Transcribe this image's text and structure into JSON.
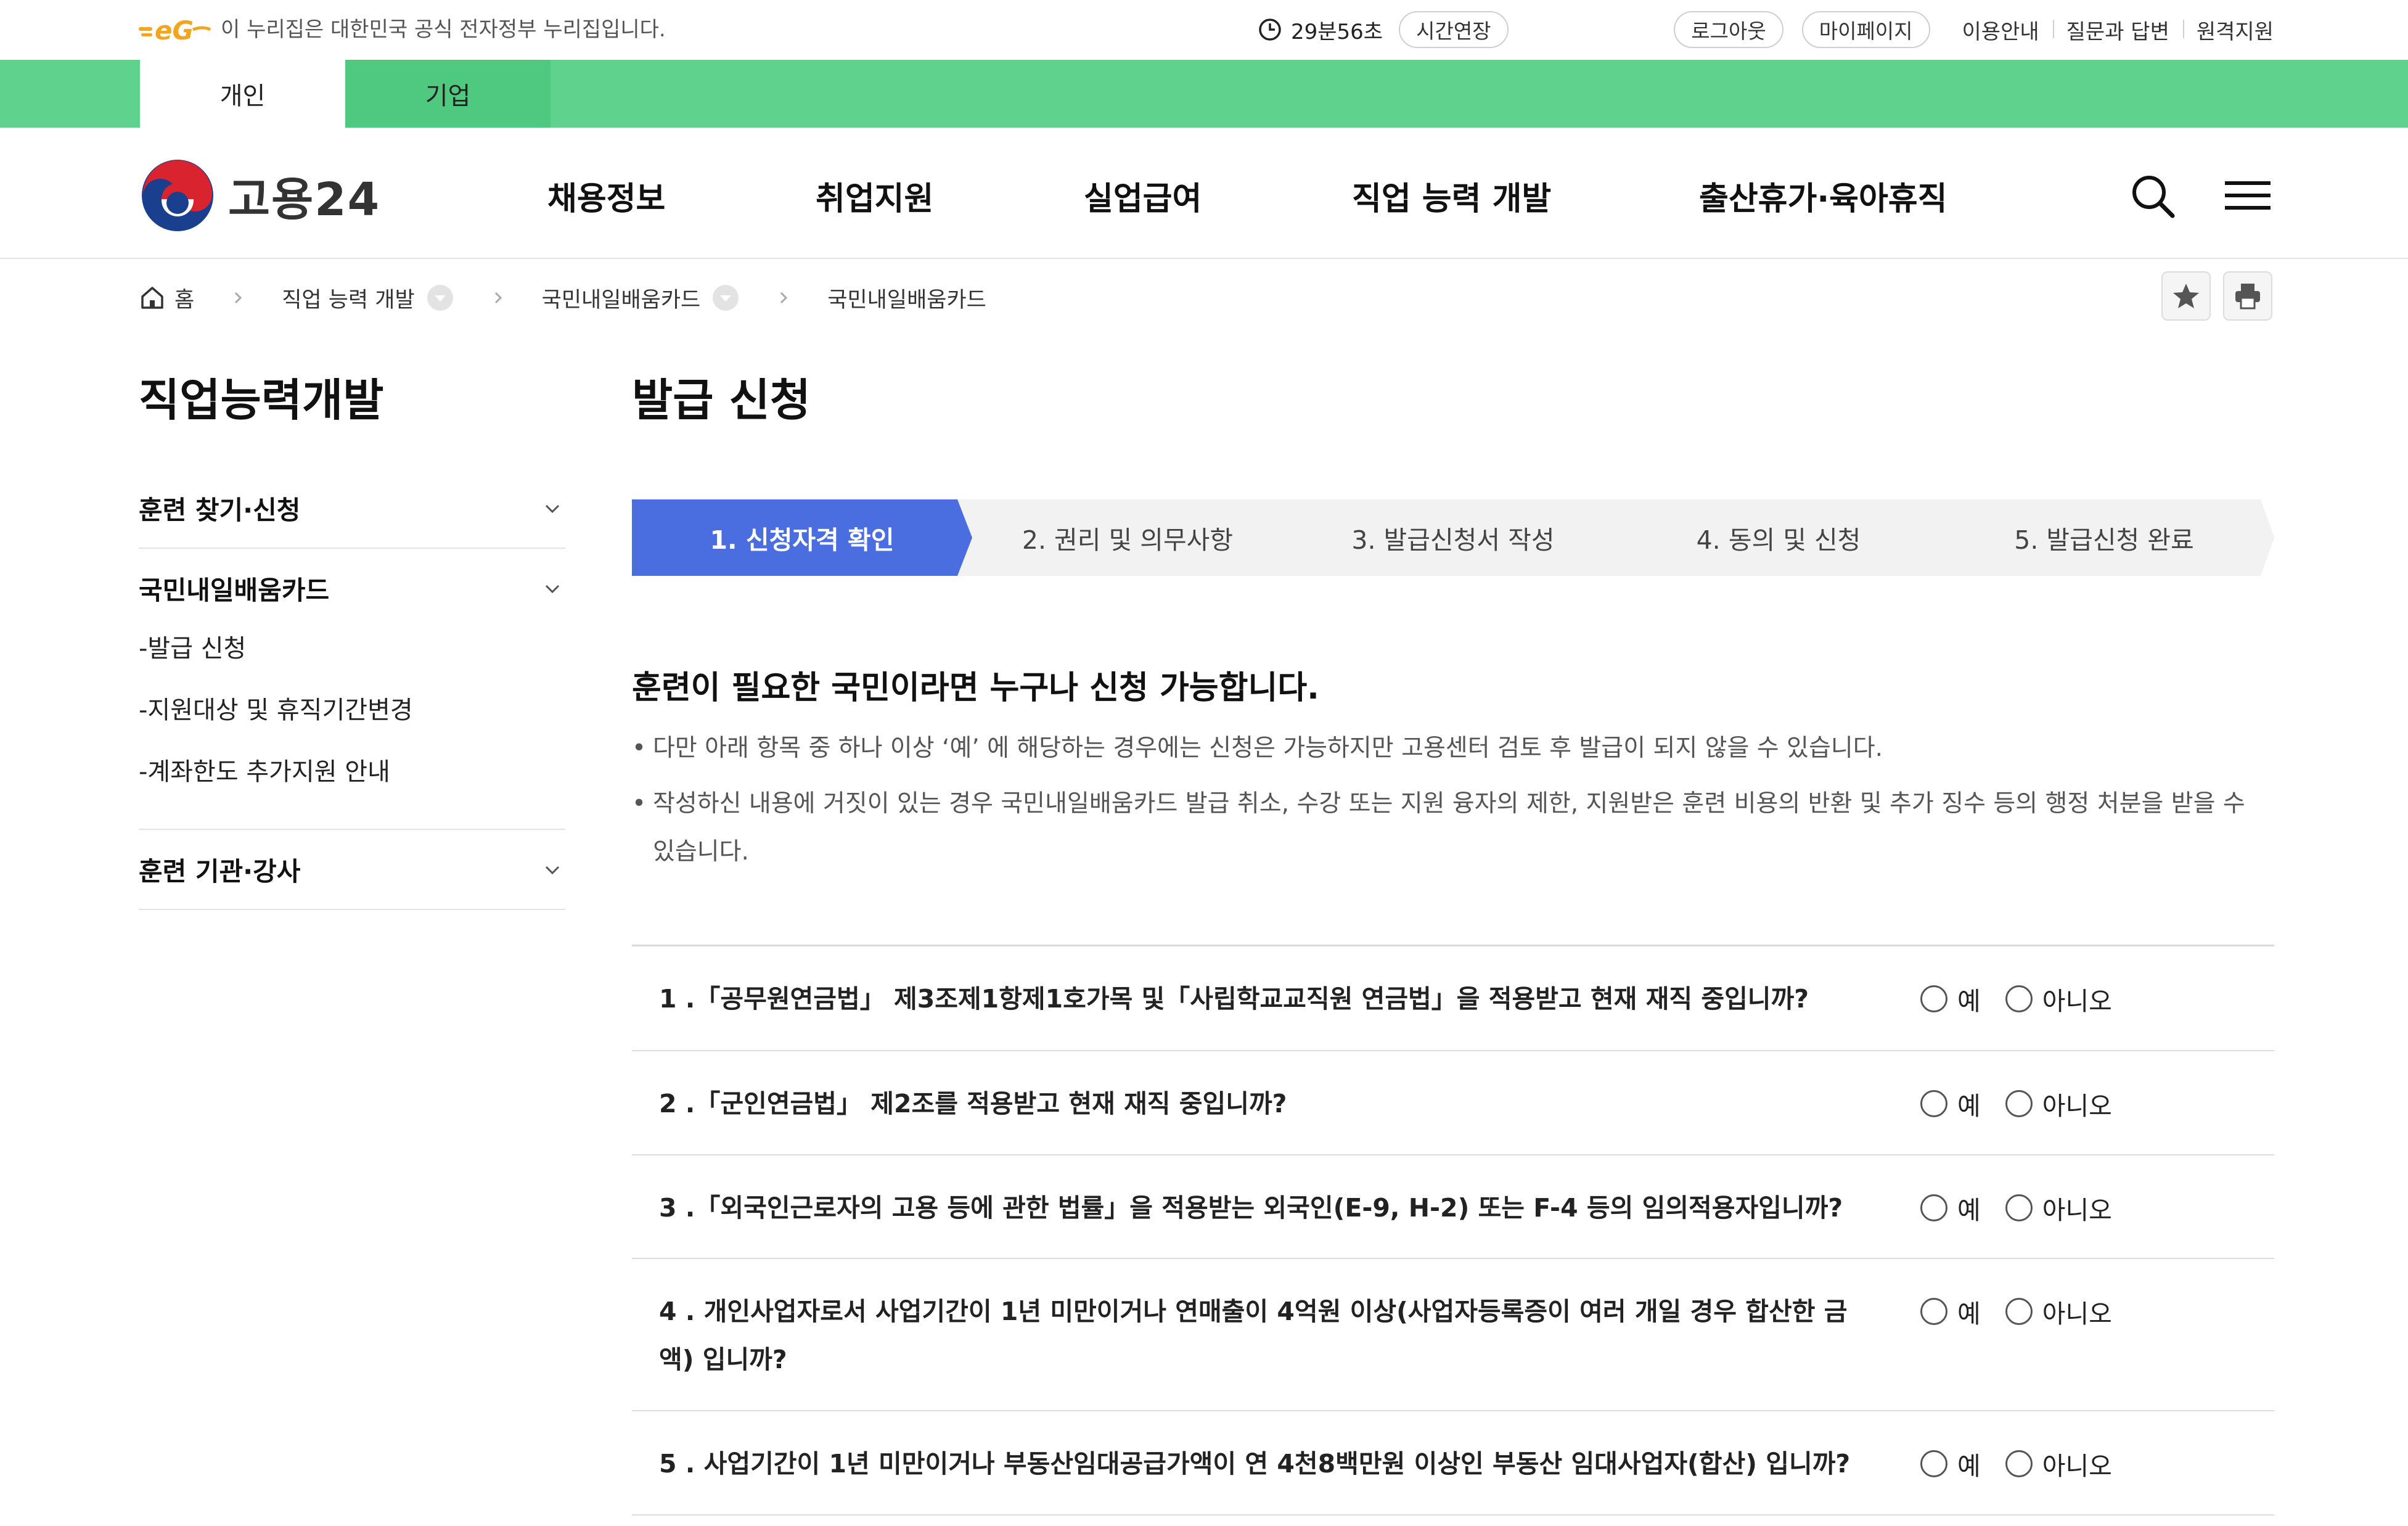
{
  "util": {
    "gov_notice": "이 누리집은 대한민국 공식 전자정부 누리집입니다.",
    "timer": "29분56초",
    "extend_label": "시간연장",
    "logout_label": "로그아웃",
    "mypage_label": "마이페이지",
    "links": [
      "이용안내",
      "질문과 답변",
      "원격지원"
    ]
  },
  "user_tabs": [
    "개인",
    "기업"
  ],
  "brand": {
    "name": "고용24"
  },
  "gnb": [
    "채용정보",
    "취업지원",
    "실업급여",
    "직업 능력 개발",
    "출산휴가·육아휴직"
  ],
  "breadcrumb": [
    "홈",
    "직업 능력 개발",
    "국민내일배움카드",
    "국민내일배움카드"
  ],
  "lnb": {
    "title": "직업능력개발",
    "groups": [
      {
        "label": "훈련 찾기·신청",
        "items": []
      },
      {
        "label": "국민내일배움카드",
        "items": [
          "-발급 신청",
          "-지원대상 및 휴직기간변경",
          "-계좌한도 추가지원 안내"
        ]
      },
      {
        "label": "훈련 기관·강사",
        "items": []
      }
    ]
  },
  "main": {
    "title": "발급 신청",
    "steps": [
      "1. 신청자격 확인",
      "2. 권리 및 의무사항",
      "3. 발급신청서 작성",
      "4. 동의 및 신청",
      "5. 발급신청 완료"
    ],
    "active_step": 1,
    "notice_head": "훈련이 필요한 국민이라면 누구나 신청 가능합니다.",
    "notices": [
      "다만 아래 항목 중 하나 이상 ‘예’ 에 해당하는 경우에는 신청은 가능하지만 고용센터 검토 후 발급이 되지 않을 수 있습니다.",
      "작성하신 내용에 거짓이 있는 경우 국민내일배움카드 발급 취소, 수강 또는 지원 융자의 제한, 지원받은 훈련 비용의 반환 및 추가 징수 등의 행정 처분을 받을 수 있습니다."
    ],
    "option_yes": "예",
    "option_no": "아니오",
    "questions": [
      "1 .「공무원연금법」 제3조제1항제1호가목 및「사립학교교직원 연금법」을 적용받고 현재 재직 중입니까?",
      "2 .「군인연금법」 제2조를 적용받고 현재 재직 중입니까?",
      "3 .「외국인근로자의 고용 등에 관한 법률」을 적용받는 외국인(E-9, H-2) 또는 F-4 등의 임의적용자입니까?",
      "4 . 개인사업자로서 사업기간이 1년 미만이거나 연매출이 4억원 이상(사업자등록증이 여러 개일 경우 합산한 금액) 입니까?",
      "5 . 사업기간이 1년 미만이거나 부동산임대공급가액이 연 4천8백만원 이상인 부동산 임대사업자(합산) 입니까?"
    ]
  },
  "colors": {
    "green_bar": "#5fd38e",
    "step_active": "#4a6ee0",
    "step_inactive": "#f2f2f2"
  },
  "icons": [
    "eg-logo",
    "clock-icon",
    "taeguk-logo",
    "search-icon",
    "hamburger-icon",
    "home-icon",
    "chevron-right-icon",
    "dropdown-circle-icon",
    "star-icon",
    "print-icon",
    "chevron-down-icon"
  ]
}
